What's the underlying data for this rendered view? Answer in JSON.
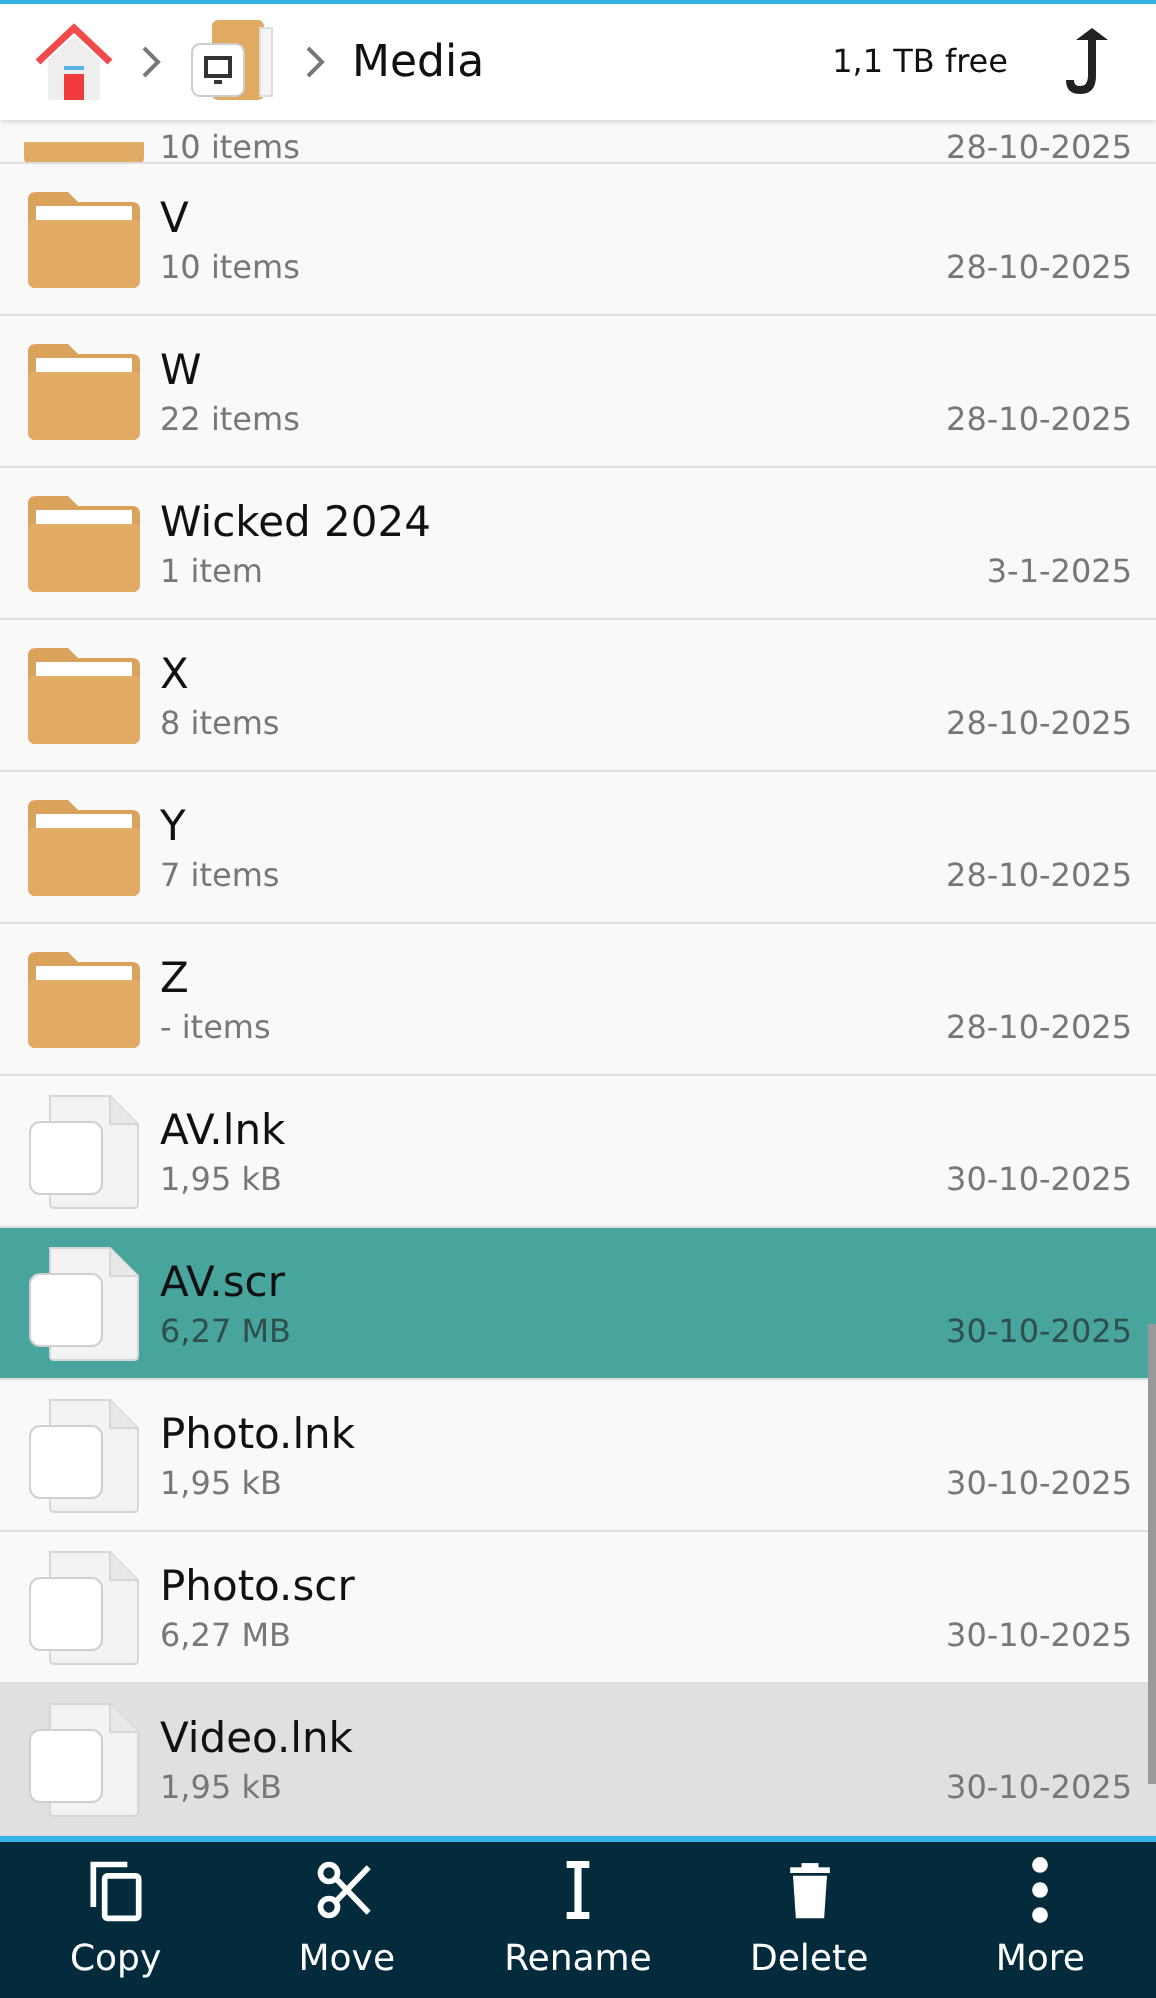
{
  "header": {
    "breadcrumb": [
      {
        "kind": "home"
      },
      {
        "kind": "device"
      },
      {
        "kind": "text",
        "label": "Media"
      }
    ],
    "free_space": "1,1 TB free"
  },
  "partial_row": {
    "kind": "folder",
    "detail": "10 items",
    "date": "28-10-2025"
  },
  "items": [
    {
      "kind": "folder",
      "name": "V",
      "detail": "10 items",
      "date": "28-10-2025",
      "selected": false,
      "pressed": false
    },
    {
      "kind": "folder",
      "name": "W",
      "detail": "22 items",
      "date": "28-10-2025",
      "selected": false,
      "pressed": false
    },
    {
      "kind": "folder",
      "name": "Wicked 2024",
      "detail": "1 item",
      "date": "3-1-2025",
      "selected": false,
      "pressed": false
    },
    {
      "kind": "folder",
      "name": "X",
      "detail": "8 items",
      "date": "28-10-2025",
      "selected": false,
      "pressed": false
    },
    {
      "kind": "folder",
      "name": "Y",
      "detail": "7 items",
      "date": "28-10-2025",
      "selected": false,
      "pressed": false
    },
    {
      "kind": "folder",
      "name": "Z",
      "detail": "- items",
      "date": "28-10-2025",
      "selected": false,
      "pressed": false
    },
    {
      "kind": "file",
      "name": "AV.lnk",
      "detail": "1,95 kB",
      "date": "30-10-2025",
      "selected": false,
      "pressed": false
    },
    {
      "kind": "file",
      "name": "AV.scr",
      "detail": "6,27 MB",
      "date": "30-10-2025",
      "selected": true,
      "pressed": false
    },
    {
      "kind": "file",
      "name": "Photo.lnk",
      "detail": "1,95 kB",
      "date": "30-10-2025",
      "selected": false,
      "pressed": false
    },
    {
      "kind": "file",
      "name": "Photo.scr",
      "detail": "6,27 MB",
      "date": "30-10-2025",
      "selected": false,
      "pressed": false
    },
    {
      "kind": "file",
      "name": "Video.lnk",
      "detail": "1,95 kB",
      "date": "30-10-2025",
      "selected": false,
      "pressed": true
    }
  ],
  "toolbar": [
    {
      "kind": "copy",
      "label": "Copy"
    },
    {
      "kind": "move",
      "label": "Move"
    },
    {
      "kind": "rename",
      "label": "Rename"
    },
    {
      "kind": "delete",
      "label": "Delete"
    },
    {
      "kind": "more",
      "label": "More"
    }
  ]
}
